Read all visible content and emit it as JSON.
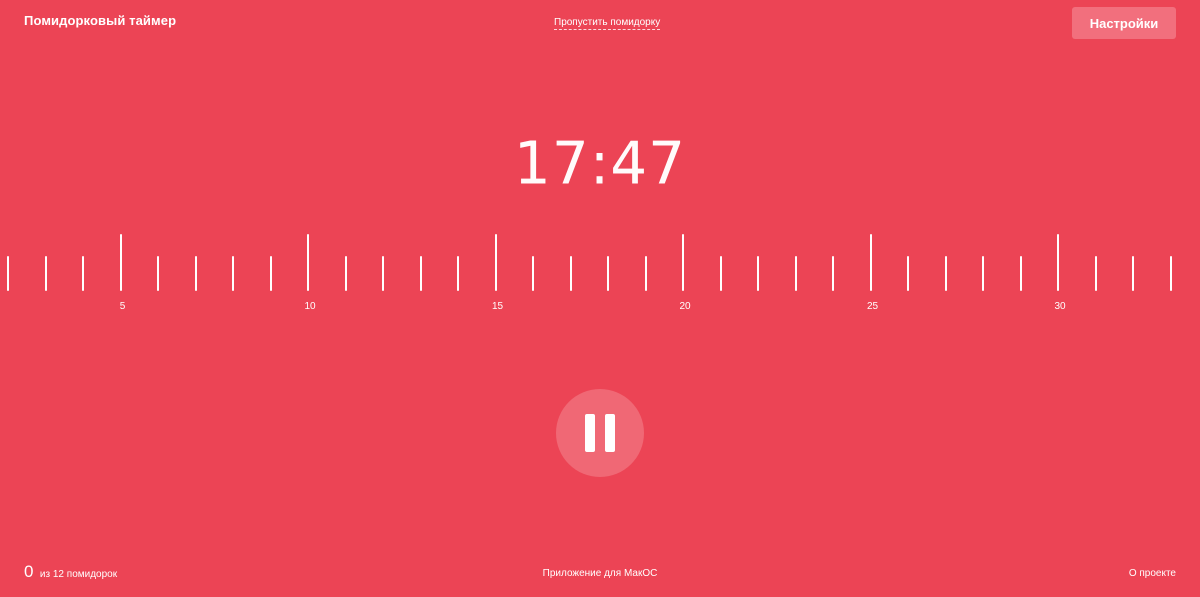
{
  "header": {
    "app_title": "Помидорковый таймер",
    "skip_label": "Пропустить помидорку",
    "settings_label": "Настройки"
  },
  "timer": {
    "value": "17:47"
  },
  "scale": {
    "labels": [
      "5",
      "10",
      "15",
      "20",
      "25",
      "30"
    ]
  },
  "controls": {
    "state_icon": "pause-icon"
  },
  "footer": {
    "done_count": "0",
    "counter_text": "из 12 помидорок",
    "mac_app_label": "Приложение для МакОС",
    "about_label": "О проекте"
  },
  "colors": {
    "background": "#ec4455",
    "button_bg": "#f26f7d",
    "pause_bg": "#f06875",
    "text": "#ffffff"
  }
}
